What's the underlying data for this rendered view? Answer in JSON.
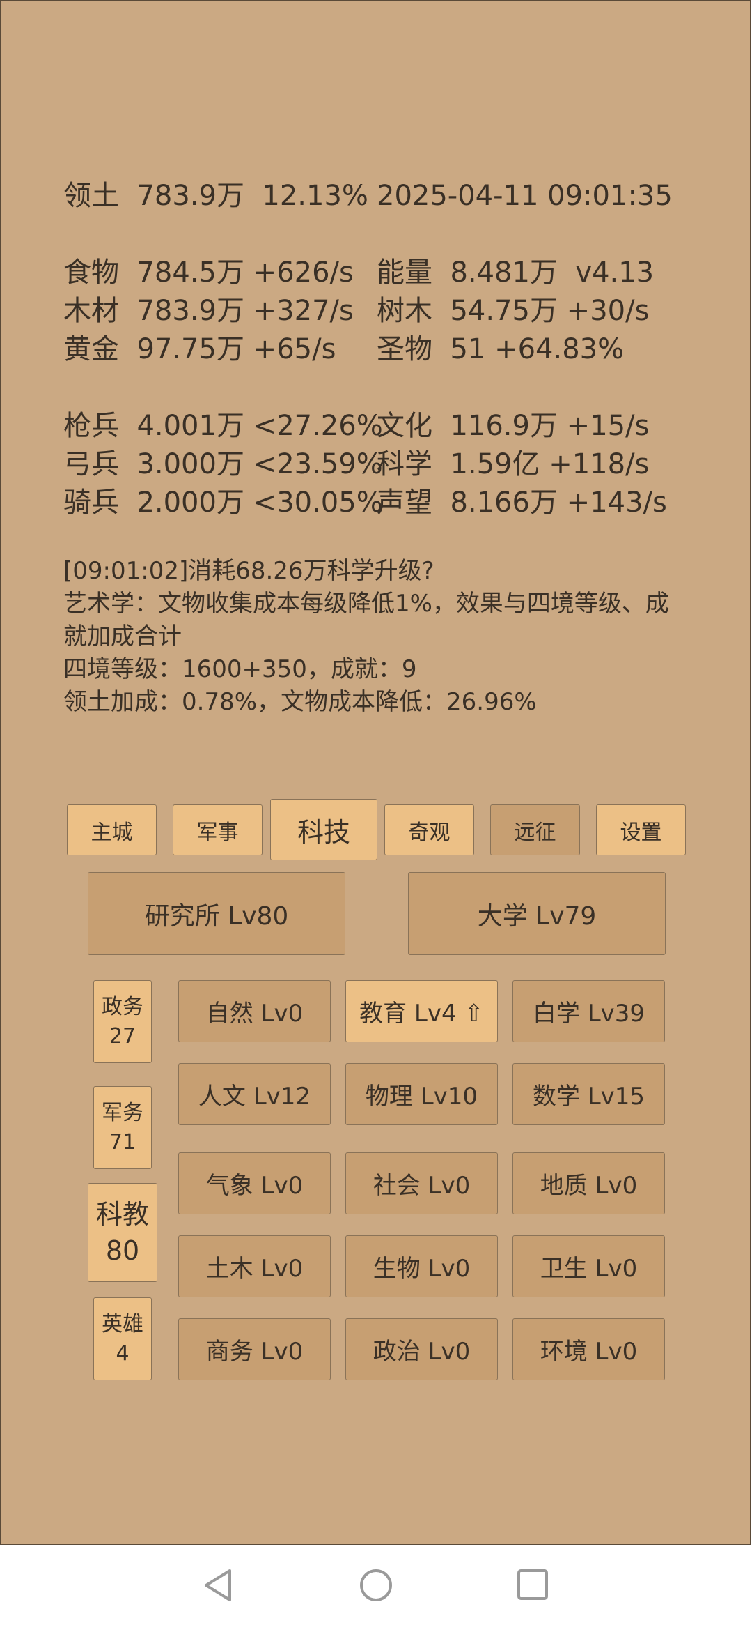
{
  "stats": {
    "territory": {
      "label": "领土",
      "value": "783.9万",
      "pct": "12.13%"
    },
    "datetime": "2025-04-11 09:01:35",
    "food": {
      "label": "食物",
      "value": "784.5万",
      "rate": "+626/s"
    },
    "energy": {
      "label": "能量",
      "value": "8.481万",
      "extra": "v4.13"
    },
    "wood": {
      "label": "木材",
      "value": "783.9万",
      "rate": "+327/s"
    },
    "tree": {
      "label": "树木",
      "value": "54.75万",
      "rate": "+30/s"
    },
    "gold": {
      "label": "黄金",
      "value": "97.75万",
      "rate": "+65/s"
    },
    "relic": {
      "label": "圣物",
      "value": "51",
      "rate": "+64.83%"
    },
    "spear": {
      "label": "枪兵",
      "value": "4.001万",
      "rate": "<27.26%"
    },
    "culture": {
      "label": "文化",
      "value": "116.9万",
      "rate": "+15/s"
    },
    "archer": {
      "label": "弓兵",
      "value": "3.000万",
      "rate": "<23.59%"
    },
    "science": {
      "label": "科学",
      "value": "1.59亿",
      "rate": "+118/s"
    },
    "cavalry": {
      "label": "骑兵",
      "value": "2.000万",
      "rate": "<30.05%"
    },
    "prestige": {
      "label": "声望",
      "value": "8.166万",
      "rate": "+143/s"
    }
  },
  "log": [
    "[09:01:02]消耗68.26万科学升级?",
    "艺术学：文物收集成本每级降低1%，效果与四境等级、成就加成合计",
    "四境等级：1600+350，成就：9",
    "领土加成：0.78%，文物成本降低：26.96%"
  ],
  "tabs": [
    "主城",
    "军事",
    "科技",
    "奇观",
    "远征",
    "设置"
  ],
  "buildings": [
    "研究所 Lv80",
    "大学 Lv79"
  ],
  "side": [
    {
      "name": "政务",
      "value": "27"
    },
    {
      "name": "军务",
      "value": "71"
    },
    {
      "name": "科教",
      "value": "80"
    },
    {
      "name": "英雄",
      "value": "4"
    }
  ],
  "grid": [
    [
      "自然 Lv0",
      "教育 Lv4 ⇧",
      "白学 Lv39"
    ],
    [
      "人文 Lv12",
      "物理 Lv10",
      "数学 Lv15"
    ],
    [
      "气象 Lv0",
      "社会 Lv0",
      "地质 Lv0"
    ],
    [
      "土木 Lv0",
      "生物 Lv0",
      "卫生 Lv0"
    ],
    [
      "商务 Lv0",
      "政治 Lv0",
      "环境 Lv0"
    ]
  ],
  "colors": {
    "background": "#cba983",
    "button_light": "#ecc086",
    "button_dark": "#c79f72",
    "text": "#3a3026"
  },
  "nav_icons": [
    "back-triangle-icon",
    "home-circle-icon",
    "recents-square-icon"
  ]
}
